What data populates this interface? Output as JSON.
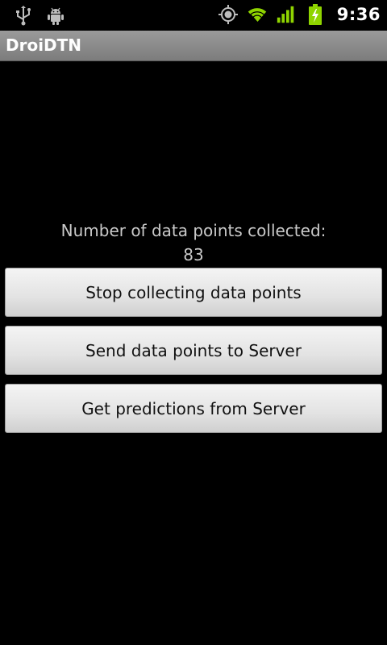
{
  "status_bar": {
    "time": "9:36",
    "left_icons": [
      "usb-icon",
      "android-debug-icon"
    ],
    "right_icons": [
      "gps-icon",
      "wifi-icon",
      "signal-icon",
      "battery-charging-icon"
    ],
    "accent_color": "#8fd400"
  },
  "app": {
    "title": "DroiDTN"
  },
  "main": {
    "count_label": "Number of data points collected:",
    "count_value": "83",
    "buttons": [
      {
        "label": "Stop collecting data points"
      },
      {
        "label": "Send data points to Server"
      },
      {
        "label": "Get predictions from Server"
      }
    ]
  }
}
